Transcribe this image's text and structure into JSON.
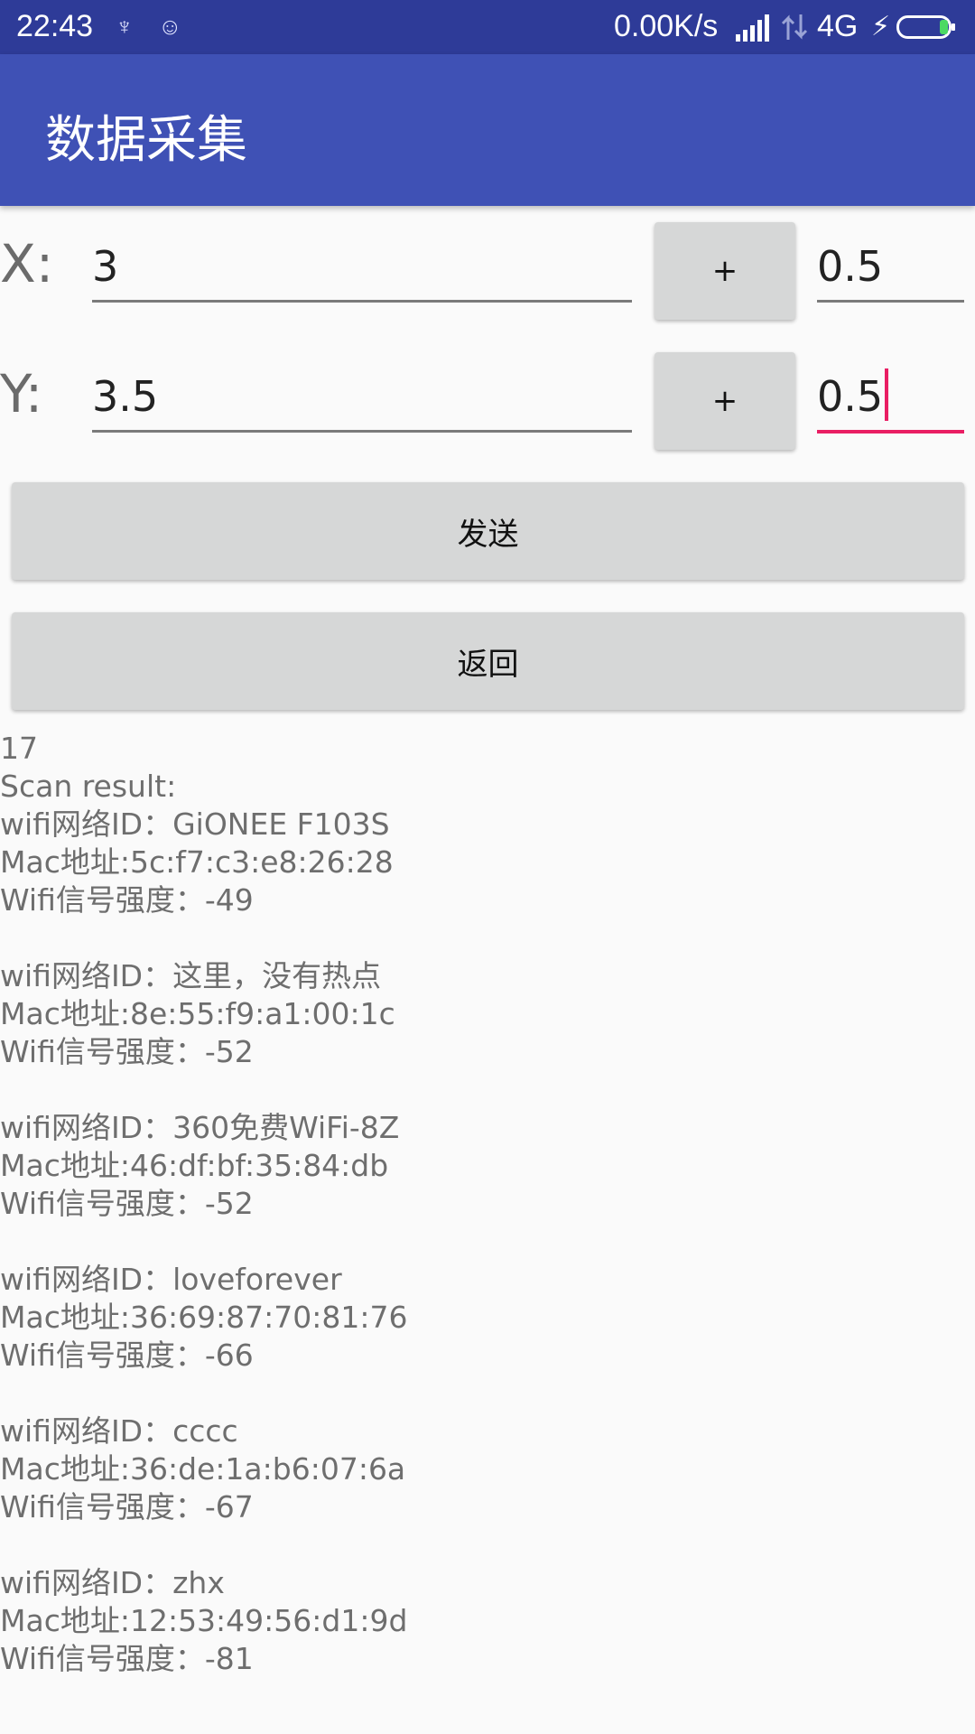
{
  "status_bar": {
    "time": "22:43",
    "notification_icons": [
      "usb-icon",
      "android-debug-icon"
    ],
    "net_speed": "0.00K/s",
    "network_type": "4G",
    "icons": [
      "signal-icon",
      "data-transfer-icon",
      "charging-bolt-icon",
      "battery-icon"
    ]
  },
  "app_bar": {
    "title": "数据采集"
  },
  "form": {
    "x": {
      "label": "X:",
      "value": "3",
      "plus": "+",
      "step": "0.5"
    },
    "y": {
      "label": "Y:",
      "value": "3.5",
      "plus": "+",
      "step": "0.5"
    }
  },
  "buttons": {
    "send": "发送",
    "back": "返回"
  },
  "scan": {
    "count": "17",
    "header": "Scan result:",
    "results": [
      {
        "id": "wifi网络ID：GiONEE F103S",
        "mac": "Mac地址:5c:f7:c3:e8:26:28",
        "rssi": "Wifi信号强度：-49"
      },
      {
        "id": "wifi网络ID：这里，没有热点",
        "mac": "Mac地址:8e:55:f9:a1:00:1c",
        "rssi": "Wifi信号强度：-52"
      },
      {
        "id": "wifi网络ID：360免费WiFi-8Z",
        "mac": "Mac地址:46:df:bf:35:84:db",
        "rssi": "Wifi信号强度：-52"
      },
      {
        "id": "wifi网络ID：loveforever",
        "mac": "Mac地址:36:69:87:70:81:76",
        "rssi": "Wifi信号强度：-66"
      },
      {
        "id": "wifi网络ID：cccc",
        "mac": "Mac地址:36:de:1a:b6:07:6a",
        "rssi": "Wifi信号强度：-67"
      },
      {
        "id": "wifi网络ID：zhx",
        "mac": "Mac地址:12:53:49:56:d1:9d",
        "rssi": "Wifi信号强度：-81"
      }
    ]
  },
  "colors": {
    "status_bar": "#2e3b98",
    "app_bar": "#3f51b5",
    "accent": "#e91e63",
    "button": "#d6d7d7"
  }
}
